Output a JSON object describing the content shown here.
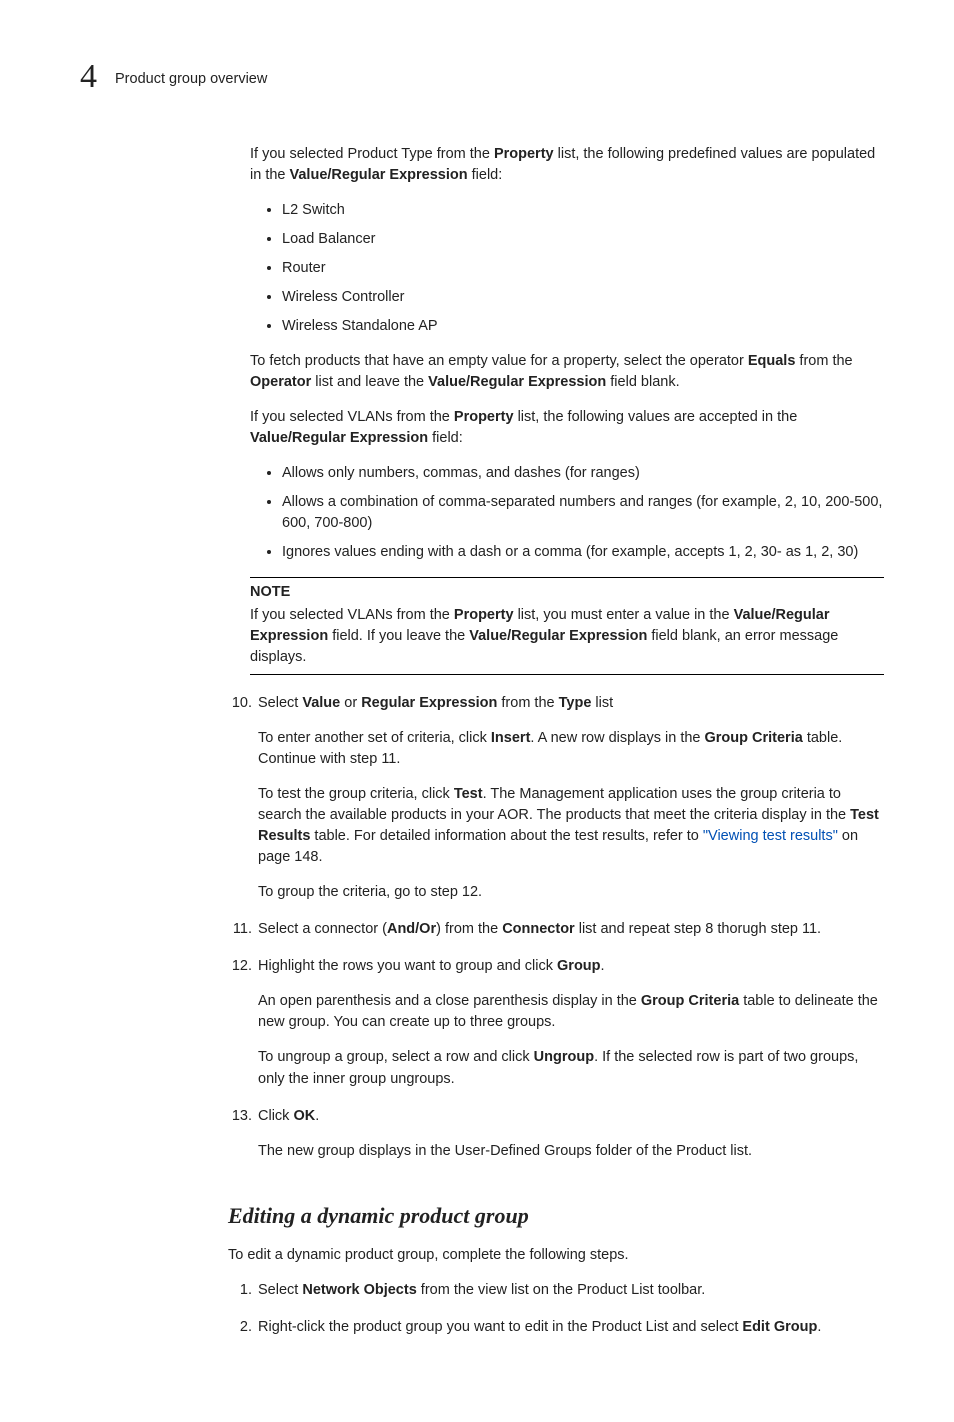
{
  "header": {
    "chapter_number": "4",
    "section_title": "Product group overview"
  },
  "intro": {
    "p1_a": "If you selected Product Type from the ",
    "p1_prop": "Property",
    "p1_b": " list, the following predefined values are populated in the ",
    "p1_vre": "Value/Regular Expression",
    "p1_c": " field:",
    "bullets1": [
      "L2 Switch",
      "Load Balancer",
      "Router",
      "Wireless Controller",
      "Wireless Standalone AP"
    ],
    "p2_a": "To fetch products that have an empty value for a property, select the operator ",
    "p2_equals": "Equals",
    "p2_b": " from the ",
    "p2_op": "Operator",
    "p2_c": " list and leave the ",
    "p2_vre": "Value/Regular Expression",
    "p2_d": " field blank.",
    "p3_a": "If you selected VLANs from the ",
    "p3_prop": "Property",
    "p3_b": " list, the following values are accepted in the ",
    "p3_vre": "Value/Regular Expression",
    "p3_c": " field:",
    "bullets2": [
      "Allows only numbers, commas, and dashes (for ranges)",
      "Allows a combination of comma-separated numbers and ranges (for example, 2, 10, 200-500, 600, 700-800)",
      "Ignores values ending with a dash or a comma (for example, accepts 1, 2, 30- as 1, 2, 30)"
    ]
  },
  "note": {
    "label": "NOTE",
    "a": "If you selected VLANs from the ",
    "prop": "Property",
    "b": " list, you must enter a value in the ",
    "vre1": "Value/Regular Expression",
    "c": " field. If you leave the ",
    "vre2": "Value/Regular Expression",
    "d": " field blank, an error message displays."
  },
  "steps": {
    "s10": {
      "num": "10.",
      "p1_a": "Select ",
      "p1_val": "Value",
      "p1_b": " or ",
      "p1_reg": "Regular Expression",
      "p1_c": " from the ",
      "p1_type": "Type",
      "p1_d": " list",
      "p2_a": "To enter another set of criteria, click ",
      "p2_ins": "Insert",
      "p2_b": ". A new row displays in the ",
      "p2_gc": "Group Criteria",
      "p2_c": " table. Continue with step 11.",
      "p3_a": "To test the group criteria, click ",
      "p3_test": "Test",
      "p3_b": ". The Management application uses the group criteria to search the available products in your AOR. The products that meet the criteria display in the ",
      "p3_tr": "Test Results",
      "p3_c": " table. For detailed information about the test results, refer to ",
      "p3_link": "\"Viewing test results\"",
      "p3_d": " on page 148.",
      "p4": "To group the criteria, go to step 12."
    },
    "s11": {
      "num": "11.",
      "a": "Select a connector (",
      "andor": "And/Or",
      "b": ") from the ",
      "conn": "Connector",
      "c": " list and repeat step 8 thorugh step 11."
    },
    "s12": {
      "num": "12.",
      "p1_a": "Highlight the rows you want to group and click ",
      "p1_group": "Group",
      "p1_b": ".",
      "p2_a": "An open parenthesis and a close parenthesis display in the ",
      "p2_gc": "Group Criteria",
      "p2_b": " table to delineate the new group. You can create up to three groups.",
      "p3_a": "To ungroup a group, select a row and click ",
      "p3_ung": "Ungroup",
      "p3_b": ". If the selected row is part of two groups, only the inner group ungroups."
    },
    "s13": {
      "num": "13.",
      "p1_a": "Click ",
      "p1_ok": "OK",
      "p1_b": ".",
      "p2": "The new group displays in the User-Defined Groups folder of the Product list."
    }
  },
  "section2": {
    "heading": "Editing a dynamic product group",
    "intro": "To edit a dynamic product group, complete the following steps.",
    "s1": {
      "num": "1.",
      "a": "Select ",
      "no": "Network Objects",
      "b": " from the view list on the Product List toolbar."
    },
    "s2": {
      "num": "2.",
      "a": "Right-click the product group you want to edit in the Product List and select ",
      "eg": "Edit Group",
      "b": "."
    }
  }
}
